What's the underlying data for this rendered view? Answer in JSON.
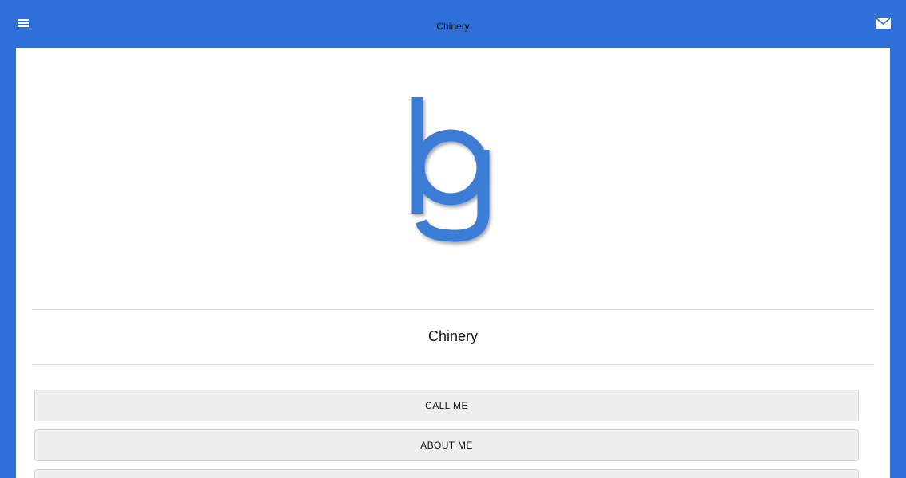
{
  "header": {
    "title": "Chinery",
    "menu_icon": "hamburger-menu-icon",
    "mail_icon": "mail-icon"
  },
  "logo": {
    "letter": "g",
    "color": "#3a7bd5"
  },
  "business": {
    "name": "Chinery"
  },
  "actions": {
    "call_label": "CALL ME",
    "about_label": "ABOUT ME",
    "third_label": ""
  },
  "colors": {
    "brand": "#2f6fd9",
    "button_bg": "#eeeeee"
  }
}
